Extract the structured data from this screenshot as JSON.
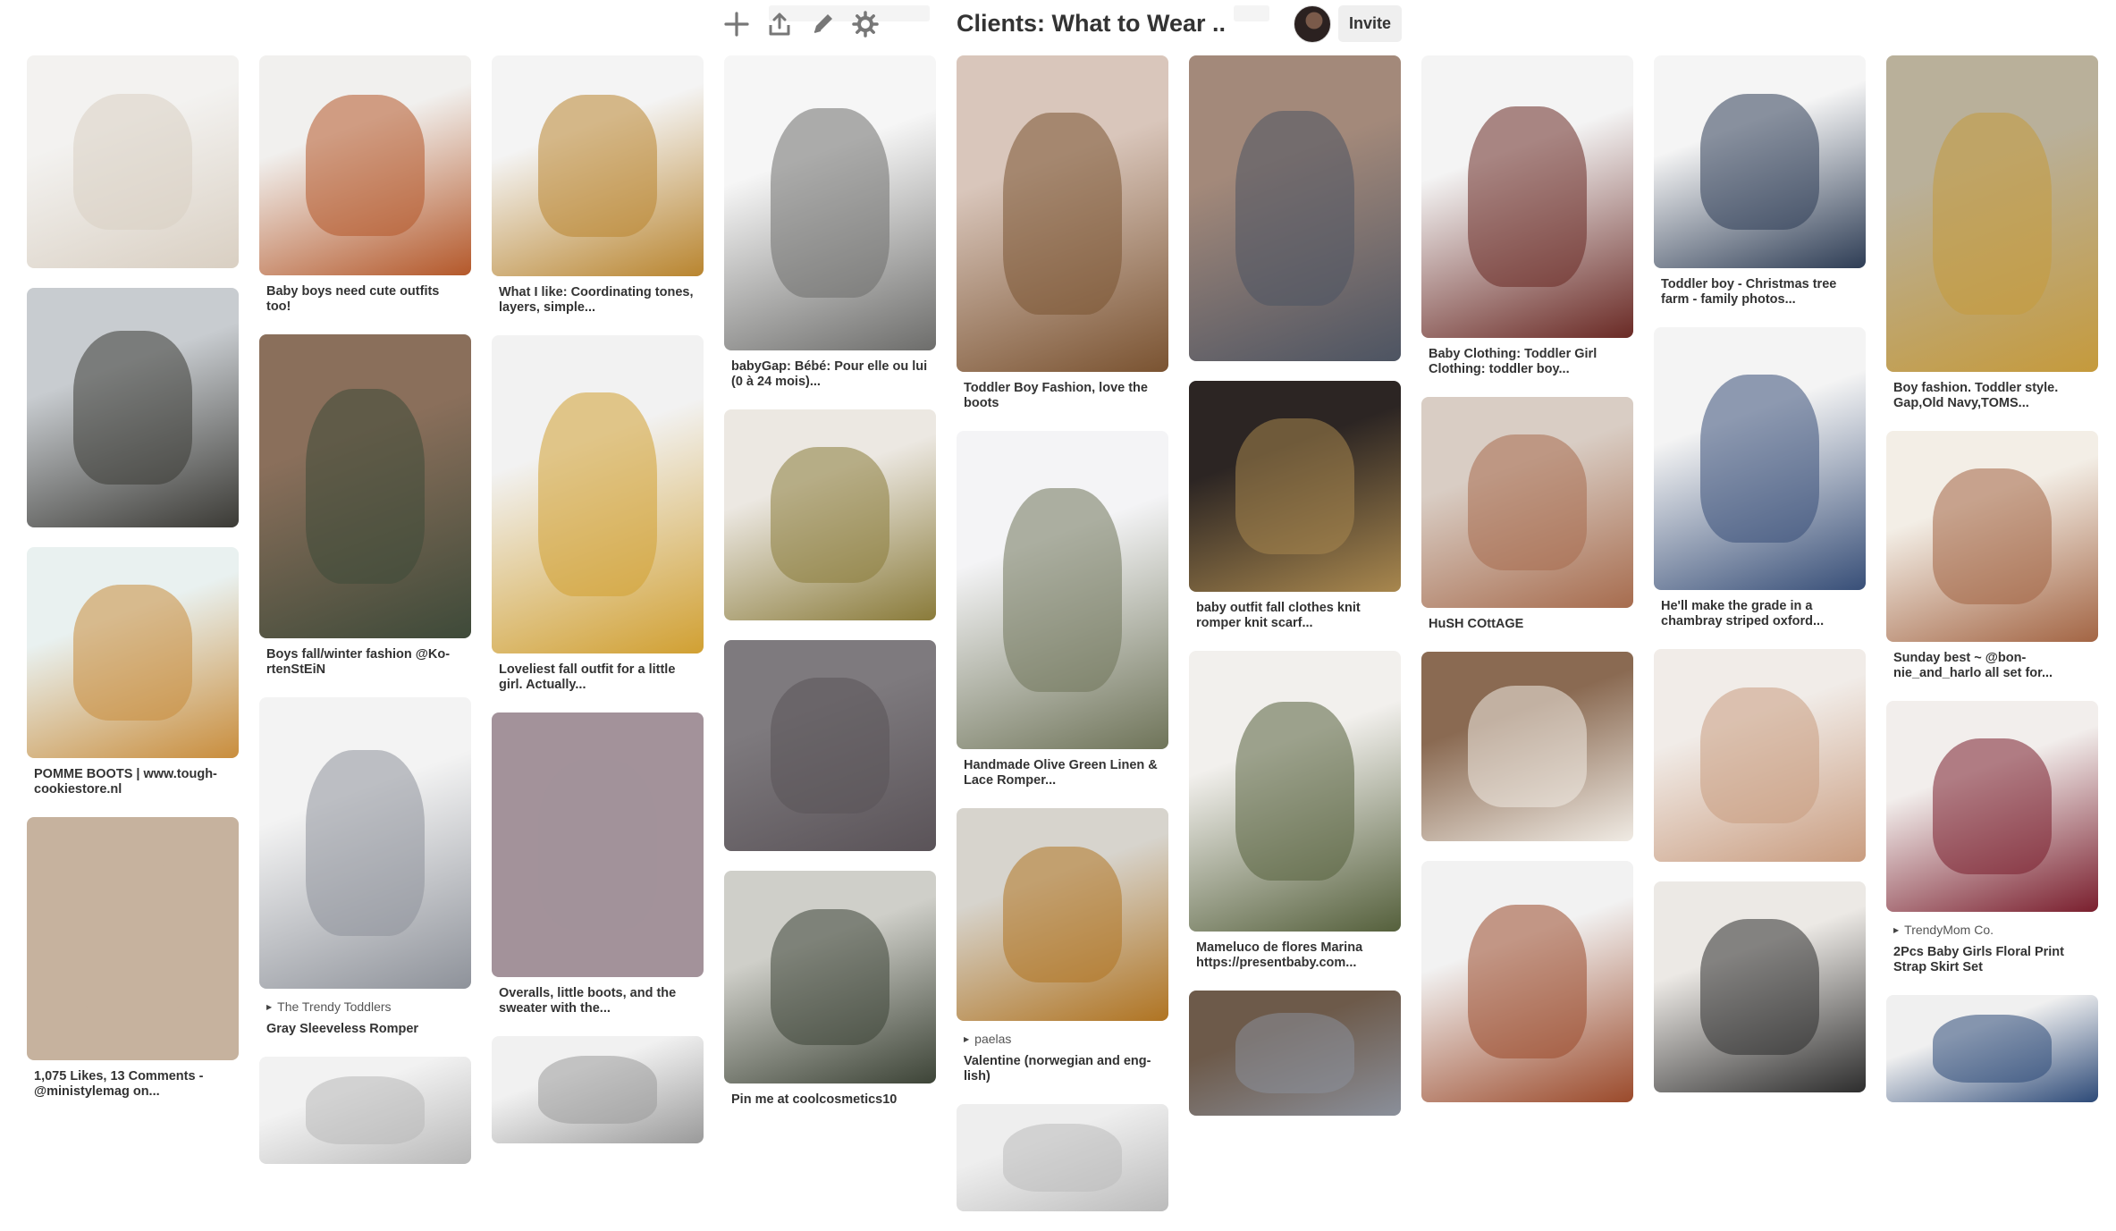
{
  "board": {
    "title": "Clients: What to Wear ...",
    "invite_label": "Invite"
  },
  "toolbar": {
    "icons": [
      "plus-icon",
      "upload-icon",
      "pencil-icon",
      "gear-icon"
    ]
  },
  "columns": [
    [
      {
        "h": 238,
        "bg": [
          "#f3f2f0",
          "#d9cfc2"
        ],
        "desc": ""
      },
      {
        "h": 268,
        "bg": [
          "#c8ccd0",
          "#3b3a35"
        ],
        "desc": ""
      },
      {
        "h": 236,
        "bg": [
          "#e9f1f0",
          "#c98d3c"
        ],
        "desc": "POMME BOOTS | www.tough-cookiestore.nl"
      },
      {
        "h": 272,
        "bg": [
          "#c6b29e",
          "#c6b29e"
        ],
        "desc": "1,075 Likes, 13 Comments - @ministylemag on..."
      }
    ],
    [
      {
        "h": 246,
        "bg": [
          "#f1f0ee",
          "#b4582a"
        ],
        "desc": "Baby boys need cute outfits too!"
      },
      {
        "h": 340,
        "bg": [
          "#8a6f5b",
          "#3e4a39"
        ],
        "desc": "Boys fall/winter fashion @Ko-rtenStEiN"
      },
      {
        "h": 326,
        "bg": [
          "#f3f3f3",
          "#8e929a"
        ],
        "source": "The Trendy Toddlers",
        "desc": "Gray Sleeveless Romper"
      },
      {
        "h": 120,
        "bg": [
          "#f2f2f2",
          "#b8b8b8"
        ],
        "desc": ""
      }
    ],
    [
      {
        "h": 247,
        "bg": [
          "#f4f4f4",
          "#b9852f"
        ],
        "desc": "What I like: Coordinating tones, layers, simple..."
      },
      {
        "h": 356,
        "bg": [
          "#f2f2f2",
          "#d1a032"
        ],
        "desc": "Loveliest fall outfit for a little girl. Actually..."
      },
      {
        "h": 296,
        "bg": [
          "#a3929a",
          "#a3929a"
        ],
        "desc": "Overalls, little boots, and the sweater with the..."
      },
      {
        "h": 120,
        "bg": [
          "#f1f1f1",
          "#9a9a9a"
        ],
        "desc": ""
      }
    ],
    [
      {
        "h": 330,
        "bg": [
          "#f6f6f6",
          "#6d6d6b"
        ],
        "desc": "babyGap: Bébé: Pour elle ou lui (0 à 24 mois)..."
      },
      {
        "h": 236,
        "bg": [
          "#ece8e2",
          "#8a7b3a"
        ],
        "desc": ""
      },
      {
        "h": 236,
        "bg": [
          "#7e7a7e",
          "#5a5358"
        ],
        "desc": ""
      },
      {
        "h": 238,
        "bg": [
          "#cfcfc9",
          "#3d4437"
        ],
        "desc": "Pin me at coolcosmetics10"
      }
    ],
    [
      {
        "h": 354,
        "bg": [
          "#d9c6bb",
          "#7a5331"
        ],
        "desc": "Toddler Boy Fashion, love the boots"
      },
      {
        "h": 356,
        "bg": [
          "#f4f4f6",
          "#6f7459"
        ],
        "desc": "Handmade Olive Green Linen & Lace Romper..."
      },
      {
        "h": 238,
        "bg": [
          "#d7d4cd",
          "#b07422"
        ],
        "source": "paelas",
        "desc": "Valentine (norwegian and eng-lish)"
      },
      {
        "h": 120,
        "bg": [
          "#eeeeee",
          "#bbbbbb"
        ],
        "desc": ""
      }
    ],
    [
      {
        "h": 342,
        "bg": [
          "#a3897a",
          "#4d5462"
        ],
        "desc": ""
      },
      {
        "h": 236,
        "bg": [
          "#2c2523",
          "#a8874e"
        ],
        "desc": "baby outfit fall clothes knit romper knit scarf..."
      },
      {
        "h": 314,
        "bg": [
          "#f2f0ed",
          "#55603c"
        ],
        "desc": "Mameluco de flores Marina https://presentbaby.com..."
      },
      {
        "h": 140,
        "bg": [
          "#6d5a4a",
          "#8a8f9a"
        ],
        "desc": ""
      }
    ],
    [
      {
        "h": 316,
        "bg": [
          "#f4f4f4",
          "#6a2a25"
        ],
        "desc": "Baby Clothing: Toddler Girl Clothing: toddler boy..."
      },
      {
        "h": 236,
        "bg": [
          "#d9cdc4",
          "#a76c4e"
        ],
        "desc": "HuSH COttAGE"
      },
      {
        "h": 212,
        "bg": [
          "#8a6a52",
          "#f0ebe4"
        ],
        "desc": ""
      },
      {
        "h": 270,
        "bg": [
          "#f2f2f2",
          "#9b4a2b"
        ],
        "desc": ""
      }
    ],
    [
      {
        "h": 238,
        "bg": [
          "#f5f5f5",
          "#2e3d55"
        ],
        "desc": "Toddler boy - Christmas tree farm - family photos..."
      },
      {
        "h": 294,
        "bg": [
          "#f4f4f4",
          "#384f78"
        ],
        "desc": "He'll make the grade in a chambray striped oxford..."
      },
      {
        "h": 238,
        "bg": [
          "#f1ece8",
          "#c99c7f"
        ],
        "desc": ""
      },
      {
        "h": 236,
        "bg": [
          "#ece9e5",
          "#2d2d2d"
        ],
        "desc": ""
      }
    ],
    [
      {
        "h": 354,
        "bg": [
          "#b9b09a",
          "#c59a3c"
        ],
        "desc": "Boy fashion. Toddler style. Gap,Old Navy,TOMS..."
      },
      {
        "h": 236,
        "bg": [
          "#f3eee6",
          "#a36544"
        ],
        "desc": "Sunday best ~ @bon-nie_and_harlo all set for..."
      },
      {
        "h": 236,
        "bg": [
          "#f2eeec",
          "#7a1f2e"
        ],
        "source": "TrendyMom Co.",
        "desc": "2Pcs Baby Girls Floral Print Strap Skirt Set"
      },
      {
        "h": 120,
        "bg": [
          "#f0f0f0",
          "#2d4a78"
        ],
        "desc": ""
      }
    ]
  ]
}
